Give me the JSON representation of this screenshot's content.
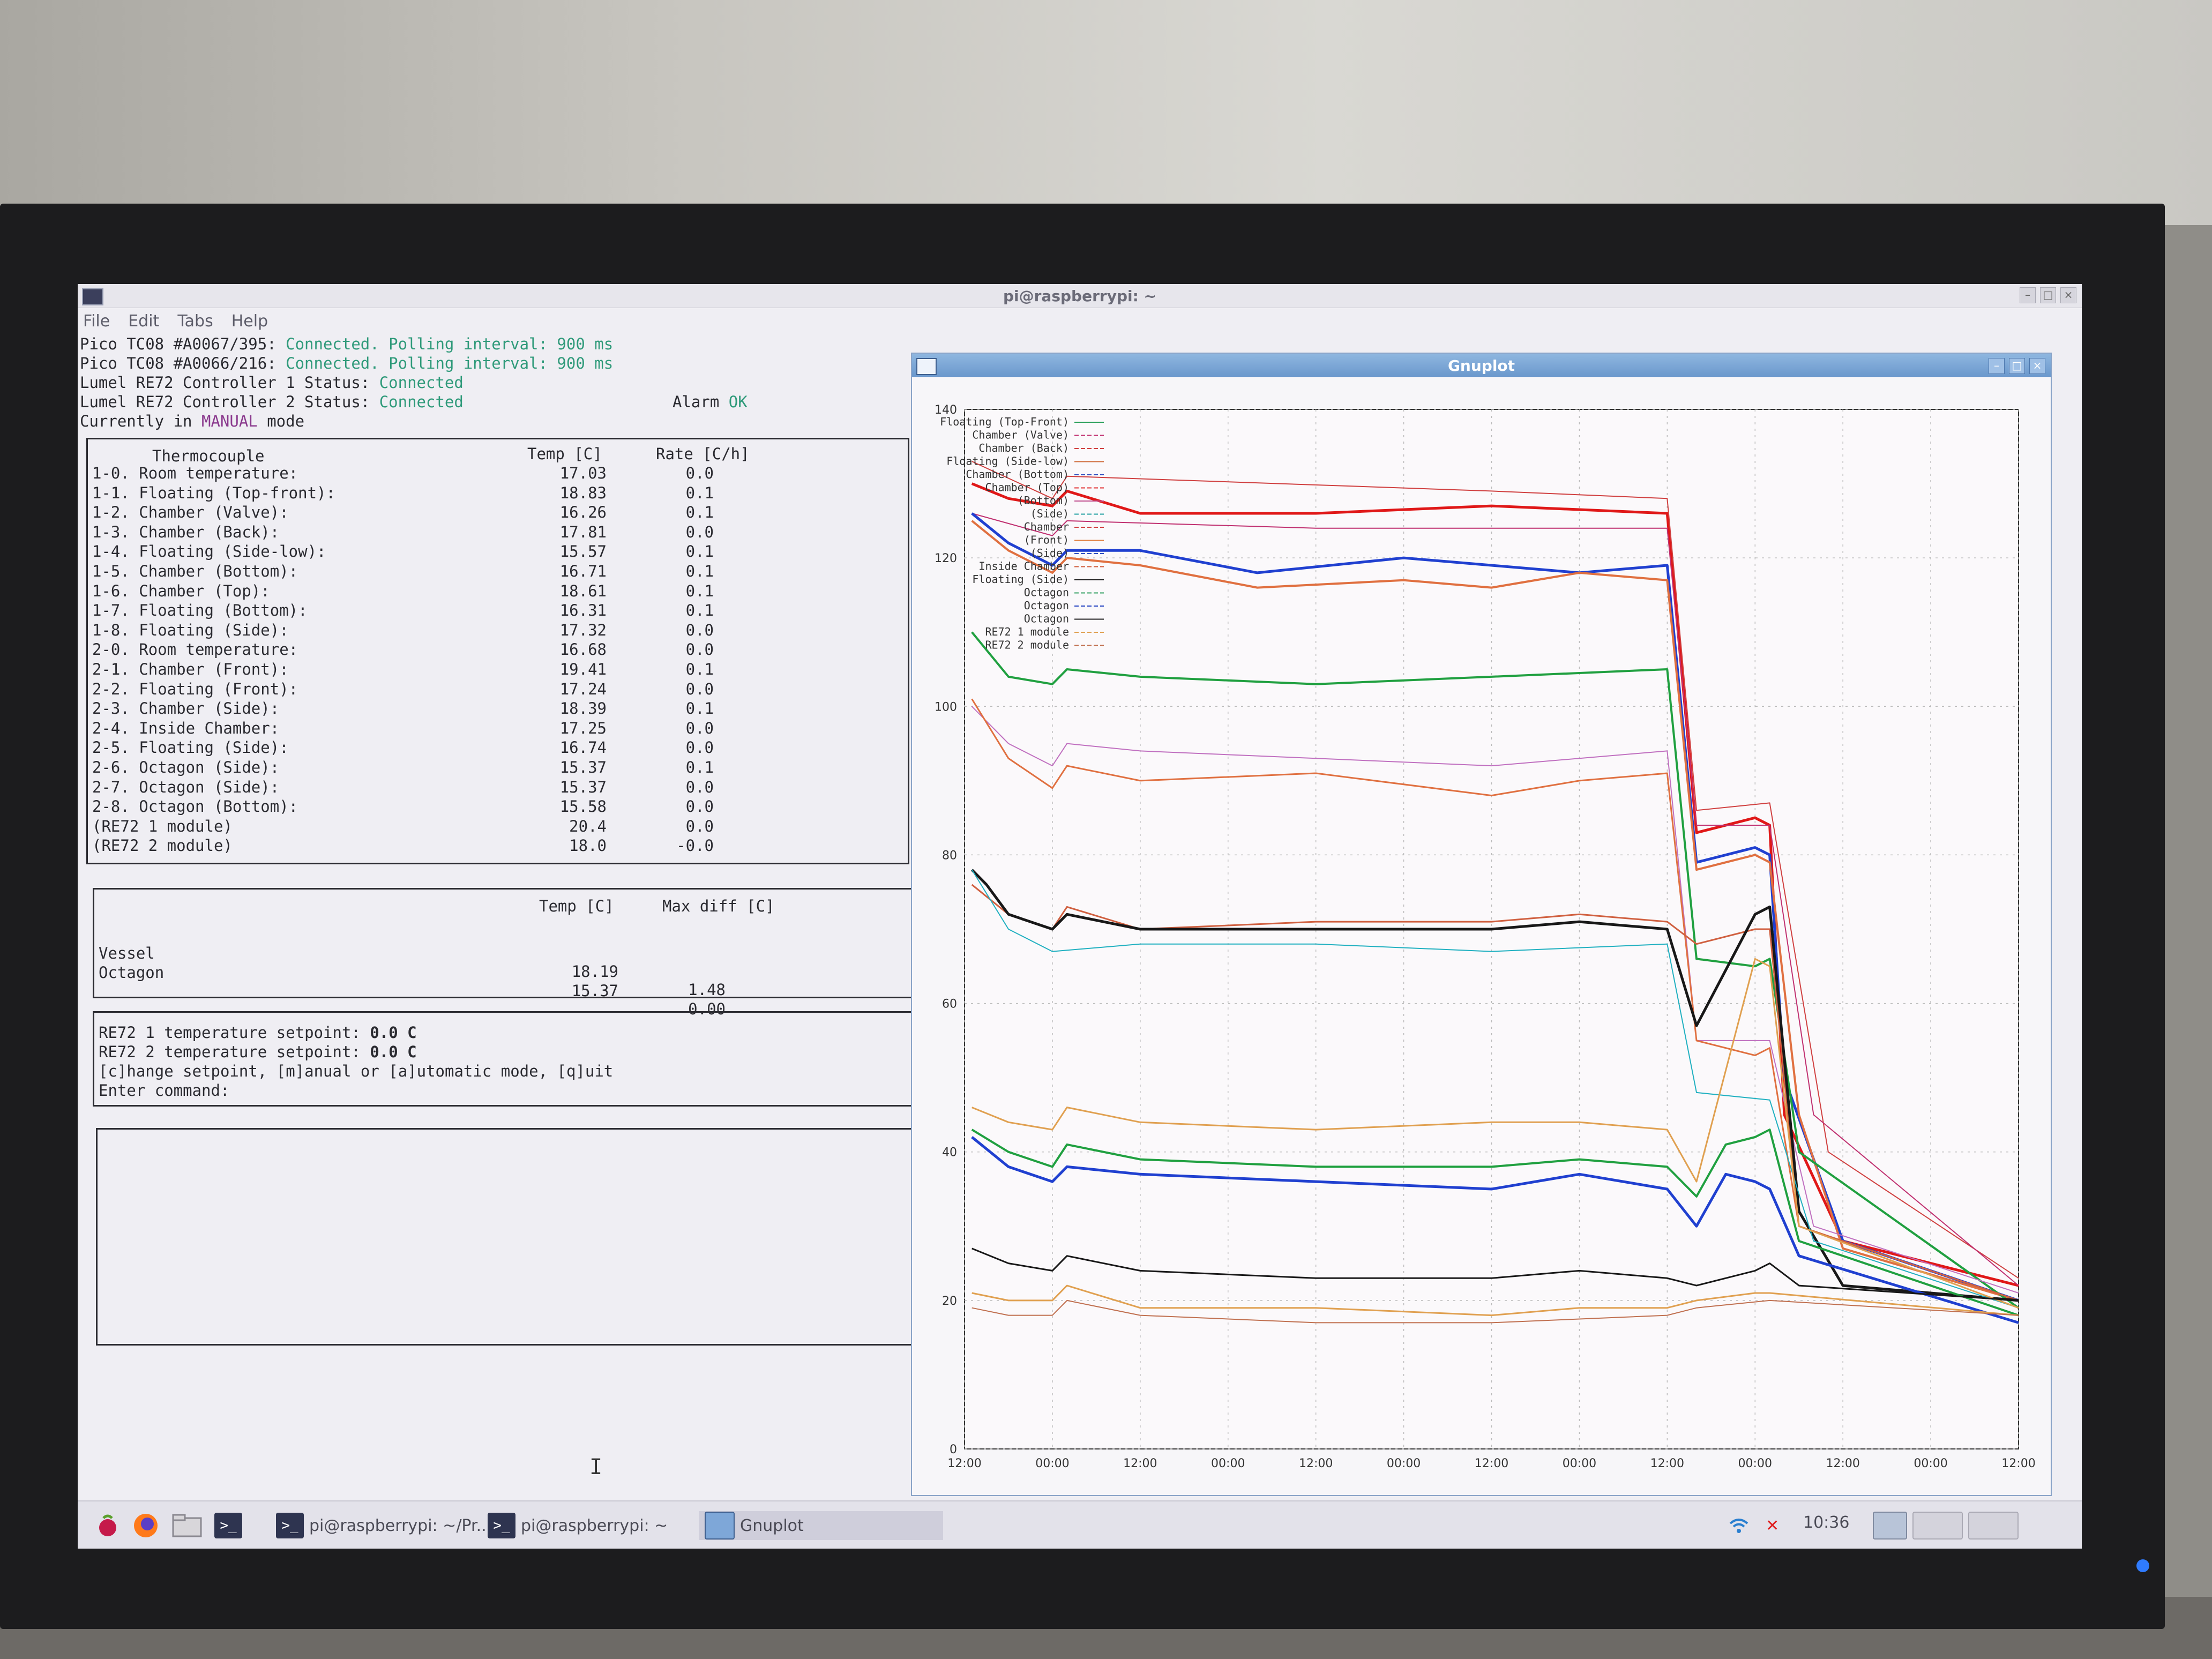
{
  "terminal": {
    "title": "pi@raspberrypi: ~",
    "menu": [
      "File",
      "Edit",
      "Tabs",
      "Help"
    ],
    "status_lines": [
      {
        "prefix": "Pico TC08 #A0067/395: ",
        "status": "Connected. Polling interval: 900 ms"
      },
      {
        "prefix": "Pico TC08 #A0066/216: ",
        "status": "Connected. Polling interval: 900 ms"
      },
      {
        "prefix": "Lumel RE72 Controller 1 Status: ",
        "status": "Connected"
      },
      {
        "prefix": "Lumel RE72 Controller 2 Status: ",
        "status": "Connected"
      }
    ],
    "alarm_label": "Alarm",
    "alarm_value": "OK",
    "mode_prefix": "Currently in ",
    "mode_value": "MANUAL",
    "mode_suffix": " mode",
    "thermo_table": {
      "headers": [
        "Thermocouple",
        "Temp [C]",
        "Rate [C/h]"
      ],
      "rows": [
        [
          "1-0. Room temperature:",
          "17.03",
          "0.0"
        ],
        [
          "1-1. Floating (Top-front):",
          "18.83",
          "0.1"
        ],
        [
          "1-2. Chamber (Valve):",
          "16.26",
          "0.1"
        ],
        [
          "1-3. Chamber (Back):",
          "17.81",
          "0.0"
        ],
        [
          "1-4. Floating (Side-low):",
          "15.57",
          "0.1"
        ],
        [
          "1-5. Chamber (Bottom):",
          "16.71",
          "0.1"
        ],
        [
          "1-6. Chamber (Top):",
          "18.61",
          "0.1"
        ],
        [
          "1-7. Floating (Bottom):",
          "16.31",
          "0.1"
        ],
        [
          "1-8. Floating (Side):",
          "17.32",
          "0.0"
        ],
        [
          "2-0. Room temperature:",
          "16.68",
          "0.0"
        ],
        [
          "2-1. Chamber (Front):",
          "19.41",
          "0.1"
        ],
        [
          "2-2. Floating (Front):",
          "17.24",
          "0.0"
        ],
        [
          "2-3. Chamber (Side):",
          "18.39",
          "0.1"
        ],
        [
          "2-4. Inside Chamber:",
          "17.25",
          "0.0"
        ],
        [
          "2-5. Floating (Side):",
          "16.74",
          "0.0"
        ],
        [
          "2-6. Octagon (Side):",
          "15.37",
          "0.1"
        ],
        [
          "2-7. Octagon (Side):",
          "15.37",
          "0.0"
        ],
        [
          "2-8. Octagon (Bottom):",
          "15.58",
          "0.0"
        ],
        [
          "(RE72 1 module)",
          "20.4",
          "0.0"
        ],
        [
          "(RE72 2 module)",
          "18.0",
          "-0.0"
        ]
      ]
    },
    "summary_table": {
      "headers": [
        "Temp [C]",
        "Max diff [C]"
      ],
      "rows": [
        [
          "Vessel",
          "18.19",
          "1.48"
        ],
        [
          "Octagon",
          "15.37",
          "0.00"
        ]
      ]
    },
    "setpoints": [
      {
        "label": "RE72 1 temperature setpoint: ",
        "value": "0.0 C"
      },
      {
        "label": "RE72 2 temperature setpoint: ",
        "value": "0.0 C"
      }
    ],
    "command_help": "[c]hange setpoint, [m]anual or [a]utomatic mode, [q]uit",
    "prompt": "Enter command:"
  },
  "gnuplot": {
    "title": "Gnuplot",
    "legend": [
      {
        "name": "Floating (Top-Front)",
        "color": "#2aa05a"
      },
      {
        "name": "Chamber (Valve)",
        "color": "#c03070"
      },
      {
        "name": "Chamber (Back)",
        "color": "#d04040"
      },
      {
        "name": "Floating (Side-low)",
        "color": "#d07040"
      },
      {
        "name": "Chamber (Bottom)",
        "color": "#3050c0"
      },
      {
        "name": "Chamber (Top)",
        "color": "#e03030"
      },
      {
        "name": "(Bottom)",
        "color": "#c05090"
      },
      {
        "name": "(Side)",
        "color": "#20a0a0"
      },
      {
        "name": "Chamber",
        "color": "#d04040"
      },
      {
        "name": "(Front)",
        "color": "#e08040"
      },
      {
        "name": "(Side)",
        "color": "#3050c0"
      },
      {
        "name": "Inside Chamber",
        "color": "#d06040"
      },
      {
        "name": "Floating (Side)",
        "color": "#202020"
      },
      {
        "name": "Octagon",
        "color": "#30a060"
      },
      {
        "name": "Octagon",
        "color": "#2040c0"
      },
      {
        "name": "Octagon",
        "color": "#202020"
      },
      {
        "name": "RE72 1 module",
        "color": "#e0a050"
      },
      {
        "name": "RE72 2 module",
        "color": "#c07050"
      }
    ]
  },
  "chart_data": {
    "type": "line",
    "title": "",
    "xlabel": "",
    "ylabel": "",
    "x_ticks": [
      "12:00",
      "00:00",
      "12:00",
      "00:00",
      "12:00",
      "00:00",
      "12:00",
      "00:00",
      "12:00",
      "00:00",
      "12:00",
      "00:00",
      "12:00"
    ],
    "y_ticks": [
      0,
      20,
      40,
      60,
      80,
      100,
      120,
      140
    ],
    "ylim": [
      0,
      140
    ],
    "xlim": [
      0,
      144
    ],
    "grid": true,
    "legend_position": "top-left",
    "x_unit": "hours from first 12:00 tick",
    "series": [
      {
        "color": "#e01818",
        "width": 5,
        "points": [
          [
            1,
            130
          ],
          [
            6,
            128
          ],
          [
            12,
            127
          ],
          [
            14,
            129
          ],
          [
            24,
            126
          ],
          [
            48,
            126
          ],
          [
            72,
            127
          ],
          [
            96,
            126
          ],
          [
            100,
            83
          ],
          [
            108,
            85
          ],
          [
            110,
            84
          ],
          [
            112,
            45
          ],
          [
            120,
            28
          ],
          [
            144,
            22
          ]
        ]
      },
      {
        "color": "#d04040",
        "width": 2,
        "points": [
          [
            1,
            133
          ],
          [
            12,
            128
          ],
          [
            14,
            131
          ],
          [
            72,
            129
          ],
          [
            96,
            128
          ],
          [
            100,
            86
          ],
          [
            110,
            87
          ],
          [
            118,
            40
          ],
          [
            144,
            23
          ]
        ]
      },
      {
        "color": "#c03070",
        "width": 2,
        "points": [
          [
            1,
            126
          ],
          [
            12,
            123
          ],
          [
            14,
            125
          ],
          [
            48,
            124
          ],
          [
            72,
            124
          ],
          [
            96,
            124
          ],
          [
            100,
            84
          ],
          [
            110,
            84
          ],
          [
            116,
            45
          ],
          [
            144,
            22
          ]
        ]
      },
      {
        "color": "#2040d0",
        "width": 5,
        "points": [
          [
            1,
            126
          ],
          [
            6,
            122
          ],
          [
            12,
            119
          ],
          [
            14,
            121
          ],
          [
            24,
            121
          ],
          [
            40,
            118
          ],
          [
            60,
            120
          ],
          [
            72,
            119
          ],
          [
            84,
            118
          ],
          [
            96,
            119
          ],
          [
            100,
            79
          ],
          [
            108,
            81
          ],
          [
            110,
            80
          ],
          [
            112,
            50
          ],
          [
            120,
            28
          ],
          [
            144,
            20
          ]
        ]
      },
      {
        "color": "#e07040",
        "width": 4,
        "points": [
          [
            1,
            125
          ],
          [
            6,
            121
          ],
          [
            12,
            118
          ],
          [
            14,
            120
          ],
          [
            24,
            119
          ],
          [
            40,
            116
          ],
          [
            60,
            117
          ],
          [
            72,
            116
          ],
          [
            84,
            118
          ],
          [
            96,
            117
          ],
          [
            100,
            78
          ],
          [
            108,
            80
          ],
          [
            110,
            79
          ],
          [
            114,
            45
          ],
          [
            120,
            27
          ],
          [
            144,
            20
          ]
        ]
      },
      {
        "color": "#20a040",
        "width": 4,
        "points": [
          [
            1,
            110
          ],
          [
            6,
            104
          ],
          [
            12,
            103
          ],
          [
            14,
            105
          ],
          [
            24,
            104
          ],
          [
            48,
            103
          ],
          [
            72,
            104
          ],
          [
            96,
            105
          ],
          [
            100,
            66
          ],
          [
            108,
            65
          ],
          [
            110,
            66
          ],
          [
            114,
            40
          ],
          [
            144,
            19
          ]
        ]
      },
      {
        "color": "#c070c0",
        "width": 2,
        "points": [
          [
            1,
            100
          ],
          [
            6,
            95
          ],
          [
            12,
            92
          ],
          [
            14,
            95
          ],
          [
            24,
            94
          ],
          [
            48,
            93
          ],
          [
            72,
            92
          ],
          [
            96,
            94
          ],
          [
            100,
            55
          ],
          [
            110,
            55
          ],
          [
            116,
            30
          ],
          [
            144,
            21
          ]
        ]
      },
      {
        "color": "#e07040",
        "width": 3,
        "points": [
          [
            1,
            101
          ],
          [
            6,
            93
          ],
          [
            12,
            89
          ],
          [
            14,
            92
          ],
          [
            24,
            90
          ],
          [
            48,
            91
          ],
          [
            72,
            88
          ],
          [
            84,
            90
          ],
          [
            96,
            91
          ],
          [
            100,
            55
          ],
          [
            108,
            53
          ],
          [
            110,
            54
          ],
          [
            114,
            30
          ],
          [
            144,
            20
          ]
        ]
      },
      {
        "color": "#d06040",
        "width": 3,
        "points": [
          [
            1,
            76
          ],
          [
            6,
            72
          ],
          [
            12,
            70
          ],
          [
            14,
            73
          ],
          [
            24,
            70
          ],
          [
            48,
            71
          ],
          [
            72,
            71
          ],
          [
            84,
            72
          ],
          [
            96,
            71
          ],
          [
            100,
            68
          ],
          [
            108,
            70
          ],
          [
            110,
            70
          ],
          [
            114,
            30
          ],
          [
            144,
            20
          ]
        ]
      },
      {
        "color": "#181818",
        "width": 5,
        "points": [
          [
            1,
            78
          ],
          [
            3,
            76
          ],
          [
            6,
            72
          ],
          [
            12,
            70
          ],
          [
            14,
            72
          ],
          [
            24,
            70
          ],
          [
            48,
            70
          ],
          [
            72,
            70
          ],
          [
            84,
            71
          ],
          [
            96,
            70
          ],
          [
            100,
            57
          ],
          [
            108,
            72
          ],
          [
            110,
            73
          ],
          [
            114,
            32
          ],
          [
            120,
            22
          ],
          [
            144,
            20
          ]
        ]
      },
      {
        "color": "#20b0c0",
        "width": 2,
        "points": [
          [
            1,
            78
          ],
          [
            6,
            70
          ],
          [
            12,
            67
          ],
          [
            24,
            68
          ],
          [
            48,
            68
          ],
          [
            72,
            67
          ],
          [
            96,
            68
          ],
          [
            100,
            48
          ],
          [
            110,
            47
          ],
          [
            116,
            28
          ],
          [
            144,
            19
          ]
        ]
      },
      {
        "color": "#e0a050",
        "width": 3,
        "points": [
          [
            1,
            46
          ],
          [
            6,
            44
          ],
          [
            12,
            43
          ],
          [
            14,
            46
          ],
          [
            24,
            44
          ],
          [
            48,
            43
          ],
          [
            72,
            44
          ],
          [
            84,
            44
          ],
          [
            96,
            43
          ],
          [
            100,
            36
          ],
          [
            108,
            66
          ],
          [
            110,
            65
          ],
          [
            114,
            30
          ],
          [
            144,
            19
          ]
        ]
      },
      {
        "color": "#20a040",
        "width": 4,
        "points": [
          [
            1,
            43
          ],
          [
            6,
            40
          ],
          [
            12,
            38
          ],
          [
            14,
            41
          ],
          [
            24,
            39
          ],
          [
            48,
            38
          ],
          [
            72,
            38
          ],
          [
            84,
            39
          ],
          [
            96,
            38
          ],
          [
            100,
            34
          ],
          [
            104,
            41
          ],
          [
            108,
            42
          ],
          [
            110,
            43
          ],
          [
            114,
            28
          ],
          [
            144,
            18
          ]
        ]
      },
      {
        "color": "#2040d0",
        "width": 5,
        "points": [
          [
            1,
            42
          ],
          [
            6,
            38
          ],
          [
            12,
            36
          ],
          [
            14,
            38
          ],
          [
            24,
            37
          ],
          [
            48,
            36
          ],
          [
            72,
            35
          ],
          [
            84,
            37
          ],
          [
            96,
            35
          ],
          [
            100,
            30
          ],
          [
            104,
            37
          ],
          [
            108,
            36
          ],
          [
            110,
            35
          ],
          [
            114,
            26
          ],
          [
            144,
            17
          ]
        ]
      },
      {
        "color": "#181818",
        "width": 3,
        "points": [
          [
            1,
            27
          ],
          [
            6,
            25
          ],
          [
            12,
            24
          ],
          [
            14,
            26
          ],
          [
            24,
            24
          ],
          [
            48,
            23
          ],
          [
            72,
            23
          ],
          [
            84,
            24
          ],
          [
            96,
            23
          ],
          [
            100,
            22
          ],
          [
            108,
            24
          ],
          [
            110,
            25
          ],
          [
            114,
            22
          ],
          [
            144,
            20
          ]
        ]
      },
      {
        "color": "#e0a050",
        "width": 3,
        "points": [
          [
            1,
            21
          ],
          [
            6,
            20
          ],
          [
            12,
            20
          ],
          [
            14,
            22
          ],
          [
            24,
            19
          ],
          [
            48,
            19
          ],
          [
            72,
            18
          ],
          [
            84,
            19
          ],
          [
            96,
            19
          ],
          [
            100,
            20
          ],
          [
            108,
            21
          ],
          [
            110,
            21
          ],
          [
            144,
            18
          ]
        ]
      },
      {
        "color": "#c07050",
        "width": 2,
        "points": [
          [
            1,
            19
          ],
          [
            6,
            18
          ],
          [
            12,
            18
          ],
          [
            14,
            20
          ],
          [
            24,
            18
          ],
          [
            48,
            17
          ],
          [
            72,
            17
          ],
          [
            96,
            18
          ],
          [
            100,
            19
          ],
          [
            110,
            20
          ],
          [
            144,
            18
          ]
        ]
      }
    ]
  },
  "taskbar": {
    "items": [
      {
        "label": "pi@raspberrypi: ~/Pr..."
      },
      {
        "label": "pi@raspberrypi: ~"
      },
      {
        "label": "Gnuplot"
      }
    ],
    "clock": "10:36"
  }
}
